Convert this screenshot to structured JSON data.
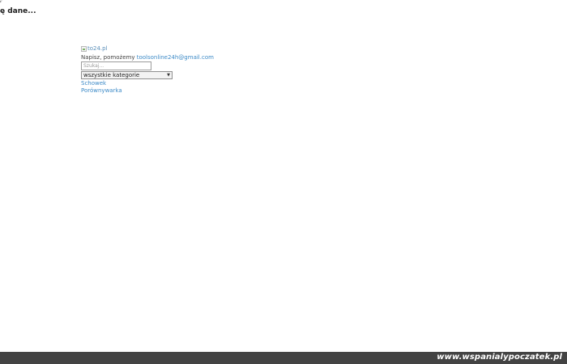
{
  "loading": {
    "text": "ę dane..."
  },
  "header": {
    "logo_alt": "to24.pl",
    "contact_prefix": "Napisz, pomożemy",
    "contact_email": "toolsonline24h@gmail.com"
  },
  "search": {
    "placeholder": "Szukaj...",
    "value": ""
  },
  "category_select": {
    "selected": "wszystkie kategorie"
  },
  "nav": {
    "clipboard_label": "Schowek",
    "compare_label": "Porównywarka"
  },
  "footer": {
    "brand": "www.wspanialypoczatek.pl"
  },
  "colors": {
    "link": "#3c8ac7",
    "footer_bg": "#434343",
    "text": "#444444"
  },
  "icons": {
    "spinner": "loading-spinner-icon",
    "broken_image": "broken-image-icon",
    "select_arrow": "triangle-down-icon"
  }
}
